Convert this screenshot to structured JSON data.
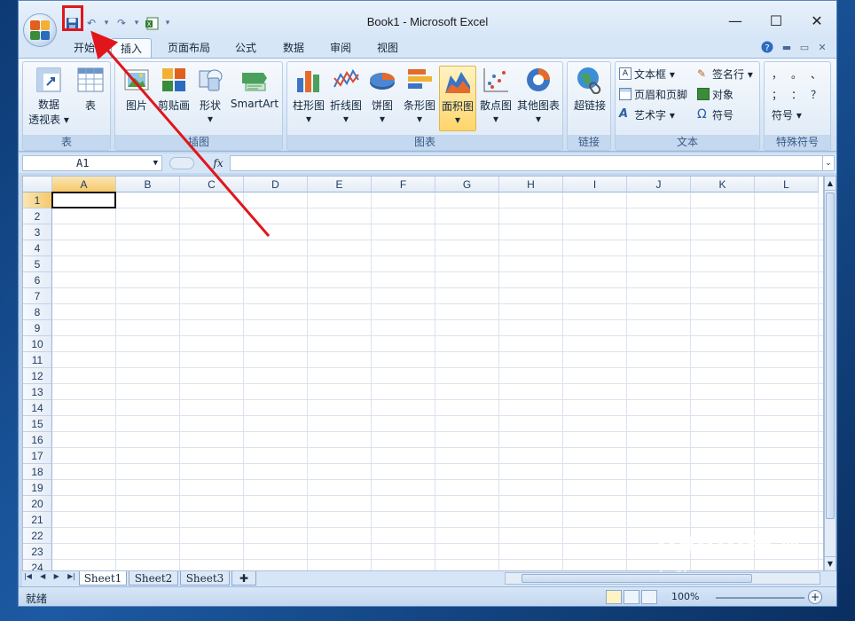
{
  "window": {
    "title": "Book1 - Microsoft Excel",
    "min_glyph": "—",
    "max_glyph": "☐",
    "close_glyph": "✕"
  },
  "qat": {
    "save_icon": "save-icon",
    "undo_glyph": "↶",
    "redo_glyph": "↷",
    "dropdown_glyph": "▾",
    "customize_glyph": "▾"
  },
  "tabs": [
    "开始",
    "插入",
    "页面布局",
    "公式",
    "数据",
    "审阅",
    "视图"
  ],
  "ribbon": {
    "groups": {
      "table": {
        "label": "表",
        "buttons": [
          "数据\n透视表 ▾",
          "表"
        ]
      },
      "illustrations": {
        "label": "插图",
        "buttons": [
          "图片",
          "剪贴画",
          "形状",
          "SmartArt"
        ]
      },
      "charts": {
        "label": "图表",
        "buttons": [
          "柱形图",
          "折线图",
          "饼图",
          "条形图",
          "面积图",
          "散点图",
          "其他图表"
        ]
      },
      "links": {
        "label": "链接",
        "buttons": [
          "超链接"
        ]
      },
      "text": {
        "label": "文本",
        "buttons": [
          "文本框 ▾",
          "页眉和页脚",
          "艺术字 ▾",
          "签名行 ▾",
          "对象",
          "符号"
        ]
      },
      "special": {
        "label": "特殊符号",
        "symbols": [
          "，",
          "。",
          "、",
          "；",
          "：",
          "？"
        ],
        "button": "符号 ▾"
      }
    }
  },
  "formula_bar": {
    "cell_ref": "A1",
    "fx": "fx",
    "formula": ""
  },
  "grid": {
    "columns": [
      "A",
      "B",
      "C",
      "D",
      "E",
      "F",
      "G",
      "H",
      "I",
      "J",
      "K",
      "L"
    ],
    "rows": [
      "1",
      "2",
      "3",
      "4",
      "5",
      "6",
      "7",
      "8",
      "9",
      "10",
      "11",
      "12",
      "13",
      "14",
      "15",
      "16",
      "17",
      "18",
      "19",
      "20",
      "21",
      "22",
      "23",
      "24"
    ],
    "active_cell": "A1"
  },
  "sheets": {
    "nav": [
      "|◀",
      "◀",
      "▶",
      "▶|"
    ],
    "tabs": [
      "Sheet1",
      "Sheet2",
      "Sheet3"
    ],
    "active": "Sheet1"
  },
  "status": {
    "text": "就绪",
    "zoom_label": "100%"
  },
  "watermark": {
    "brand": "Baidu经验",
    "url": "jingyan.baidu.com"
  },
  "colors": {
    "annotation_red": "#e0161b",
    "ribbon_blue": "#d7e6f7",
    "active_tab_bg": "#f7fbff"
  }
}
